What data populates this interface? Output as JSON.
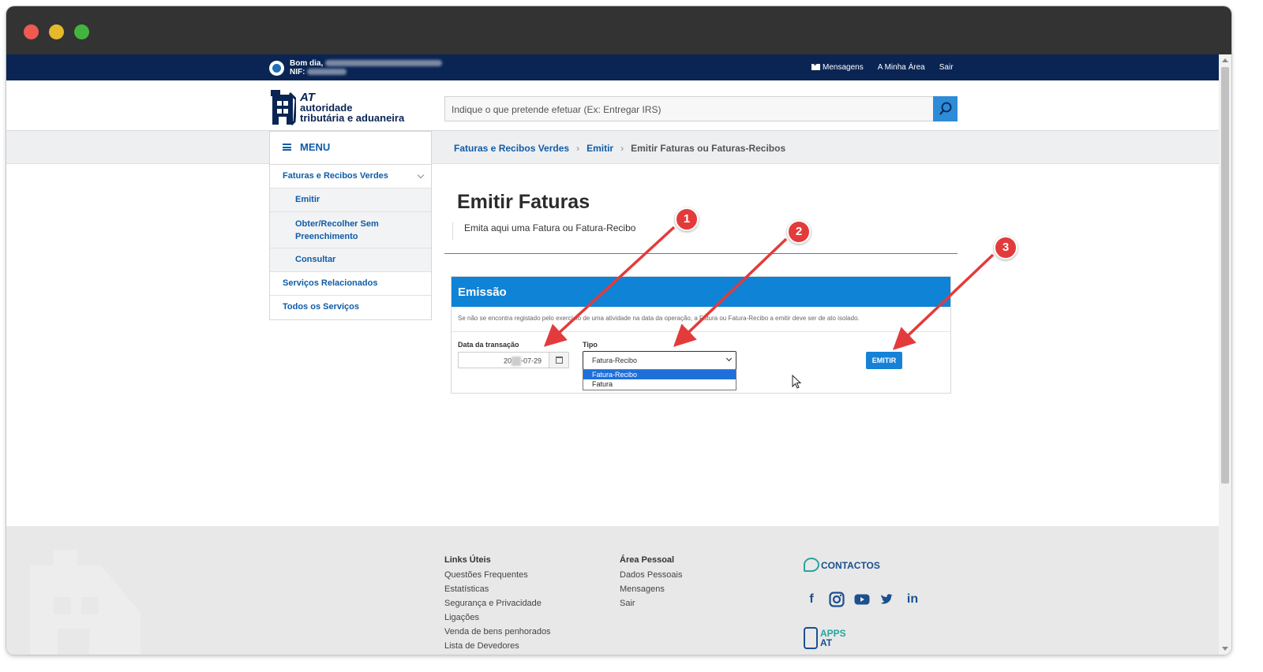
{
  "topbar": {
    "greeting": "Bom dia,",
    "nif_label": "NIF:",
    "links": [
      "Mensagens",
      "A Minha Área",
      "Sair"
    ]
  },
  "header": {
    "logo_line1": "AT",
    "logo_line2": "autoridade",
    "logo_line3": "tributária e aduaneira",
    "search_placeholder": "Indique o que pretende efetuar (Ex: Entregar IRS)"
  },
  "menu": {
    "label": "MENU"
  },
  "breadcrumb": [
    "Faturas e Recibos Verdes",
    "Emitir",
    "Emitir Faturas ou Faturas-Recibos"
  ],
  "sidebar": {
    "items": [
      {
        "label": "Faturas e Recibos Verdes",
        "sub": false
      },
      {
        "label": "Emitir",
        "sub": true
      },
      {
        "label": "Obter/Recolher Sem Preenchimento",
        "sub": true
      },
      {
        "label": "Consultar",
        "sub": true
      },
      {
        "label": "Serviços Relacionados",
        "sub": false
      },
      {
        "label": "Todos os Serviços",
        "sub": false
      }
    ]
  },
  "main": {
    "title": "Emitir Faturas",
    "subtitle": "Emita aqui uma Fatura ou Fatura-Recibo",
    "panel_title": "Emissão",
    "panel_note": "Se não se encontra registado pelo exercício de uma atividade na data da operação, a Fatura ou Fatura-Recibo a emitir deve ser de ato isolado.",
    "date_label": "Data da transação",
    "date_prefix": "20",
    "date_suffix": "-07-29",
    "type_label": "Tipo",
    "type_selected": "Fatura-Recibo",
    "type_options": [
      "Fatura-Recibo",
      "Fatura"
    ],
    "emit_button": "EMITIR"
  },
  "annotations": [
    "1",
    "2",
    "3"
  ],
  "footer": {
    "links_title": "Links Úteis",
    "links": [
      "Questões Frequentes",
      "Estatísticas",
      "Segurança e Privacidade",
      "Ligações",
      "Venda de bens penhorados",
      "Lista de Devedores"
    ],
    "personal_title": "Área Pessoal",
    "personal": [
      "Dados Pessoais",
      "Mensagens",
      "Sair"
    ],
    "contactos": "CONTACTOS",
    "apps_line1": "APPS",
    "apps_line2": "AT",
    "social": [
      "facebook-icon",
      "instagram-icon",
      "youtube-icon",
      "twitter-icon",
      "linkedin-icon"
    ]
  },
  "colors": {
    "topbar": "#0a2553",
    "accent": "#0f83d5",
    "link": "#0f5ca8",
    "annotation": "#e33b3b"
  }
}
